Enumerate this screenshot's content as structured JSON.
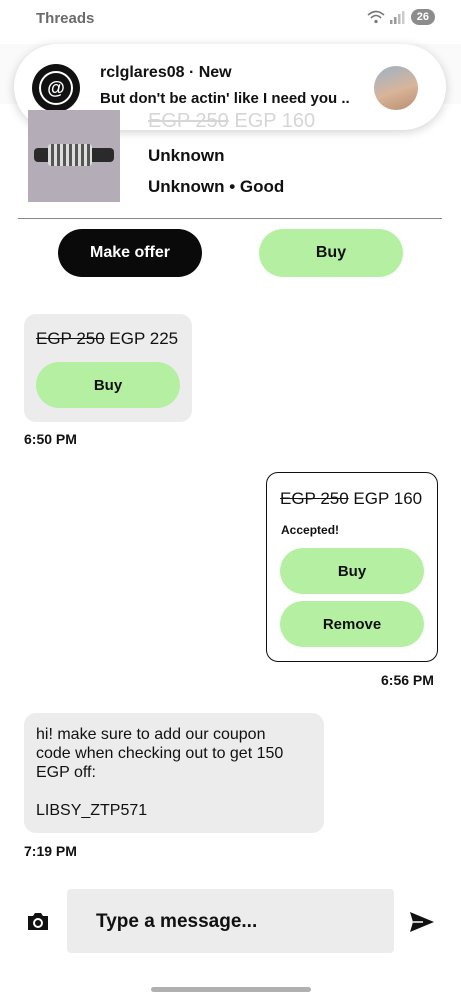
{
  "status_bar": {
    "app_name": "Threads",
    "battery": "26"
  },
  "notification": {
    "title": "rclglares08 · New",
    "body": "But don't be actin' like I need you ..."
  },
  "product": {
    "original_price": "EGP 250",
    "current_price": "EGP 160",
    "brand": "Unknown",
    "meta": "Unknown • Good"
  },
  "actions": {
    "make_offer": "Make offer",
    "buy": "Buy"
  },
  "messages": [
    {
      "type": "offer",
      "original_price": "EGP 250",
      "offer_price": "EGP 225",
      "buy_label": "Buy",
      "time": "6:50 PM"
    },
    {
      "type": "offer",
      "original_price": "EGP 250",
      "offer_price": "EGP 160",
      "status": "Accepted!",
      "buy_label": "Buy",
      "remove_label": "Remove",
      "time": "6:56 PM"
    },
    {
      "type": "text",
      "lines": [
        "hi! make sure to add our coupon",
        "code when checking out to get 150",
        "EGP off:",
        "",
        "LIBSY_ZTP571"
      ],
      "time": "7:19 PM"
    }
  ],
  "composer": {
    "placeholder": "Type a message..."
  },
  "colors": {
    "accent_green": "#b5f0a2",
    "dark_button": "#0a0a0a",
    "bubble_gray": "#ececec"
  },
  "icons": [
    "wifi-icon",
    "signal-icon",
    "threads-logo-icon",
    "camera-icon",
    "send-icon"
  ]
}
